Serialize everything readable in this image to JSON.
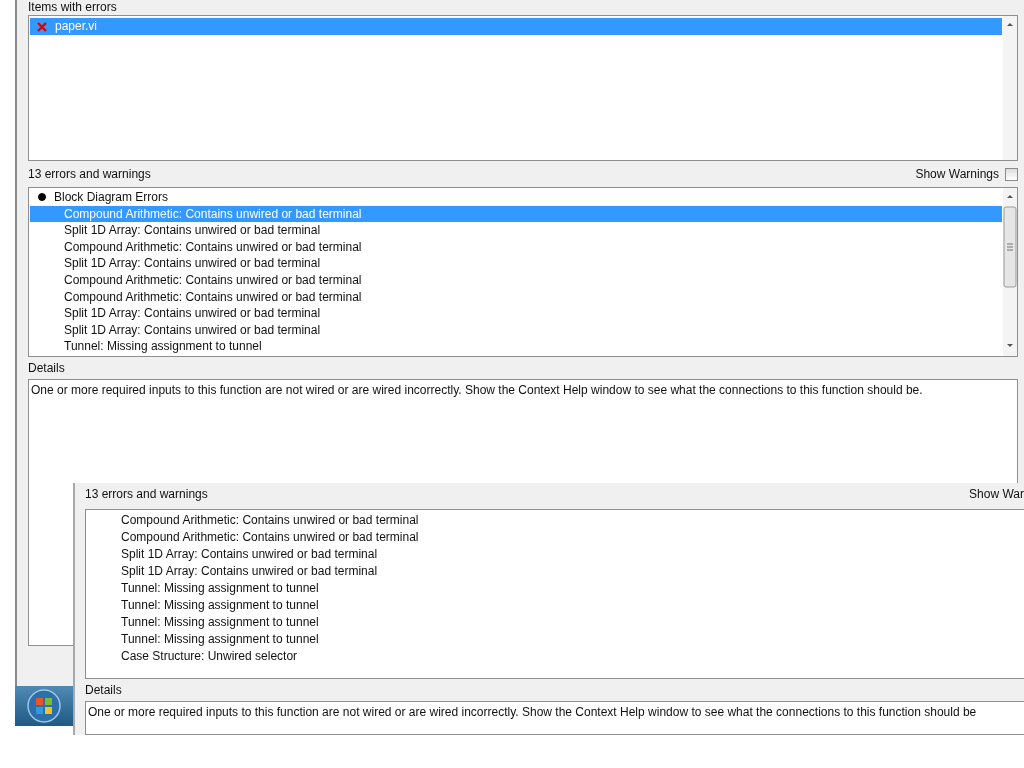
{
  "back_window": {
    "items_label": "Items with errors",
    "items": [
      {
        "name": "paper.vi",
        "selected": true
      }
    ],
    "count_label": "13 errors and warnings",
    "show_warnings": {
      "label": "Show Warnings",
      "checked": false
    },
    "error_groups": [
      {
        "title": "Block Diagram Errors",
        "expanded": true,
        "children": [
          {
            "text": "Compound Arithmetic: Contains unwired or bad terminal",
            "selected": true
          },
          {
            "text": "Split 1D Array: Contains unwired or bad terminal",
            "selected": false
          },
          {
            "text": "Compound Arithmetic: Contains unwired or bad terminal",
            "selected": false
          },
          {
            "text": "Split 1D Array: Contains unwired or bad terminal",
            "selected": false
          },
          {
            "text": "Compound Arithmetic: Contains unwired or bad terminal",
            "selected": false
          },
          {
            "text": "Compound Arithmetic: Contains unwired or bad terminal",
            "selected": false
          },
          {
            "text": "Split 1D Array: Contains unwired or bad terminal",
            "selected": false
          },
          {
            "text": "Split 1D Array: Contains unwired or bad terminal",
            "selected": false
          },
          {
            "text": "Tunnel: Missing assignment to tunnel",
            "selected": false
          }
        ]
      }
    ],
    "details_label": "Details",
    "details": "One or more required inputs to this function are not wired or are wired incorrectly. Show the Context Help window to see what the connections to this function should be."
  },
  "front_window": {
    "count_label": "13 errors and warnings",
    "show_warnings_label": "Show War",
    "errors": [
      {
        "text": "Compound Arithmetic: Contains unwired or bad terminal",
        "selected": false
      },
      {
        "text": "Compound Arithmetic: Contains unwired or bad terminal",
        "selected": false
      },
      {
        "text": "Split 1D Array: Contains unwired or bad terminal",
        "selected": false
      },
      {
        "text": "Split 1D Array: Contains unwired or bad terminal",
        "selected": false
      },
      {
        "text": "Tunnel: Missing assignment to tunnel",
        "selected": false
      },
      {
        "text": "Tunnel: Missing assignment to tunnel",
        "selected": false
      },
      {
        "text": "Tunnel: Missing assignment to tunnel",
        "selected": false
      },
      {
        "text": "Tunnel: Missing assignment to tunnel",
        "selected": false
      },
      {
        "text": "Case Structure: Unwired selector",
        "selected": false
      }
    ],
    "details_label": "Details",
    "details": "One or more required inputs to this function are not wired or are wired incorrectly. Show the Context Help window to see what the connections to this function should be"
  }
}
